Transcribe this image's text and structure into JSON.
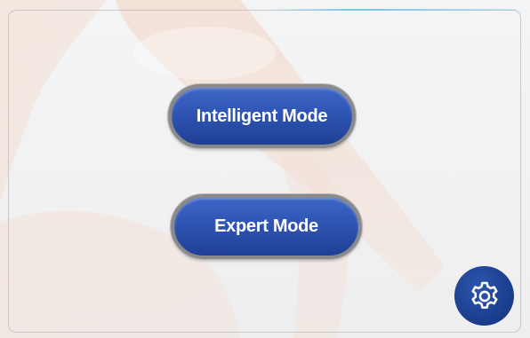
{
  "modes": {
    "intelligent_label": "Intelligent Mode",
    "expert_label": "Expert Mode"
  },
  "icons": {
    "settings": "gear-icon"
  },
  "colors": {
    "button_fill": "#2f55b3",
    "button_border": "#8a8a8c",
    "settings_fill": "#1c3f90",
    "background": "#f2f2f3"
  }
}
